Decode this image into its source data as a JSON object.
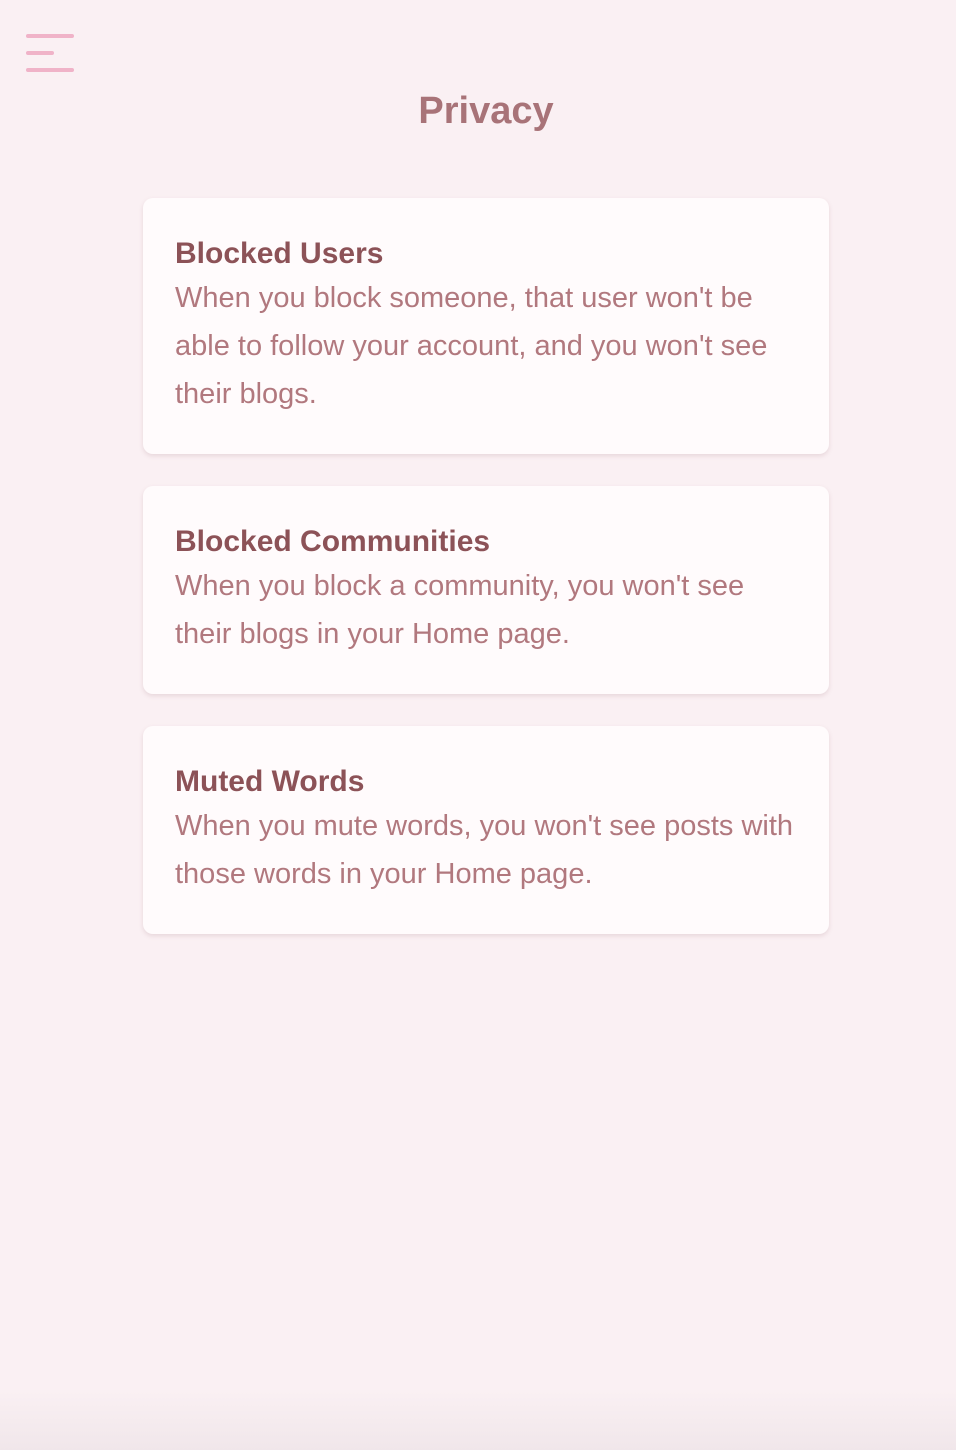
{
  "header": {
    "menu_icon": "hamburger-menu-icon",
    "title": "Privacy"
  },
  "cards": [
    {
      "title": "Blocked Users",
      "description": "When you block someone, that user won't be able to follow your account, and you won't see their blogs."
    },
    {
      "title": "Blocked Communities",
      "description": "When you block a community, you won't see their blogs in your Home page."
    },
    {
      "title": "Muted Words",
      "description": "When you mute words, you won't see posts with those words in your Home page."
    }
  ],
  "colors": {
    "background": "#faf0f3",
    "accent": "#f0b3c8",
    "title": "#a87378",
    "card_title": "#8c5257",
    "card_text": "#b1787e"
  }
}
